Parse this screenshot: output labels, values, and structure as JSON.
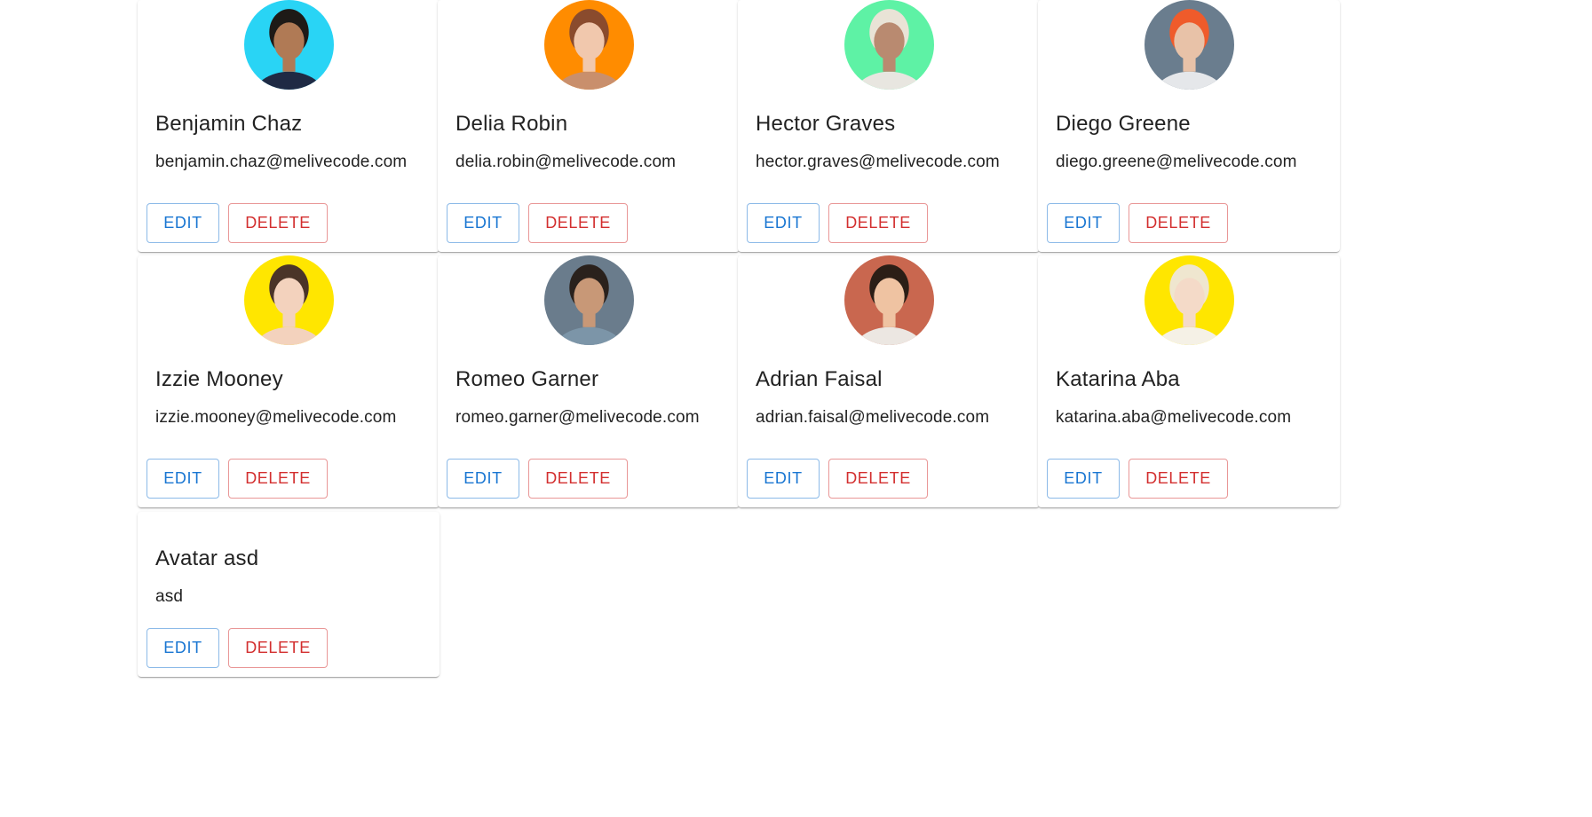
{
  "buttons": {
    "edit_label": "EDIT",
    "delete_label": "DELETE"
  },
  "colors": {
    "edit": "#1976d2",
    "delete": "#d32f2f"
  },
  "users": [
    {
      "name": "Benjamin Chaz",
      "email": "benjamin.chaz@melivecode.com",
      "avatar_bg": "#29d4f5",
      "skin": "#b07a55",
      "hair": "#1e1a17",
      "shirt": "#1f2a44"
    },
    {
      "name": "Delia Robin",
      "email": "delia.robin@melivecode.com",
      "avatar_bg": "#ff8c00",
      "skin": "#f1c8ad",
      "hair": "#8a4b2d",
      "shirt": "#c98f6c"
    },
    {
      "name": "Hector Graves",
      "email": "hector.graves@melivecode.com",
      "avatar_bg": "#5ef2a5",
      "skin": "#b98a70",
      "hair": "#e9e3d6",
      "shirt": "#e8e6e0"
    },
    {
      "name": "Diego Greene",
      "email": "diego.greene@melivecode.com",
      "avatar_bg": "#6a7d8e",
      "skin": "#e8c2a8",
      "hair": "#ef5b2b",
      "shirt": "#e5e7ea"
    },
    {
      "name": "Izzie Mooney",
      "email": "izzie.mooney@melivecode.com",
      "avatar_bg": "#ffe600",
      "skin": "#f3d2bd",
      "hair": "#4a3428",
      "shirt": "#f3d2bd"
    },
    {
      "name": "Romeo Garner",
      "email": "romeo.garner@melivecode.com",
      "avatar_bg": "#6a7c8c",
      "skin": "#c89877",
      "hair": "#2a211c",
      "shirt": "#7c95a8"
    },
    {
      "name": "Adrian Faisal",
      "email": "adrian.faisal@melivecode.com",
      "avatar_bg": "#c9674f",
      "skin": "#efc3a2",
      "hair": "#2b1e16",
      "shirt": "#ece7e2"
    },
    {
      "name": "Katarina Aba",
      "email": "katarina.aba@melivecode.com",
      "avatar_bg": "#ffe600",
      "skin": "#f4dac8",
      "hair": "#efe6cf",
      "shirt": "#f5f1e6"
    },
    {
      "name": "Avatar asd",
      "email": "asd",
      "avatar_bg": null
    }
  ]
}
